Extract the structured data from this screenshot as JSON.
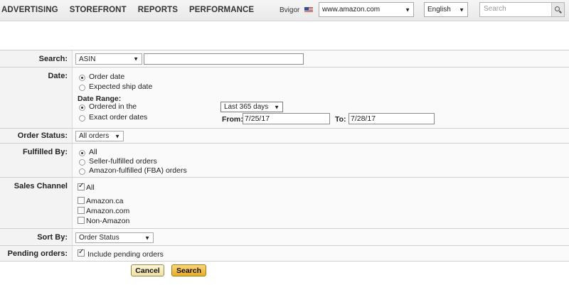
{
  "nav": {
    "items": [
      "ADVERTISING",
      "STOREFRONT",
      "REPORTS",
      "PERFORMANCE"
    ]
  },
  "header": {
    "seller_name": "Bvigor",
    "marketplace": "www.amazon.com",
    "language": "English",
    "search_placeholder": "Search"
  },
  "form": {
    "search": {
      "label": "Search:",
      "type_value": "ASIN",
      "query_value": ""
    },
    "date": {
      "label": "Date:",
      "order_date": "Order date",
      "ship_date": "Expected ship date",
      "range_label": "Date Range:",
      "ordered_in": "Ordered in the",
      "exact_dates": "Exact order dates",
      "period_value": "Last 365 days",
      "from_label": "From:",
      "from_value": "7/25/17",
      "to_label": "To:",
      "to_value": "7/28/17"
    },
    "order_status": {
      "label": "Order Status:",
      "value": "All orders"
    },
    "fulfilled_by": {
      "label": "Fulfilled By:",
      "options": [
        "All",
        "Seller-fulfilled orders",
        "Amazon-fulfilled (FBA) orders"
      ]
    },
    "sales_channel": {
      "label": "Sales Channel",
      "all": "All",
      "options": [
        "Amazon.ca",
        "Amazon.com",
        "Non-Amazon"
      ]
    },
    "sort_by": {
      "label": "Sort By:",
      "value": "Order Status"
    },
    "pending": {
      "label": "Pending orders:",
      "checkbox": "Include pending orders"
    }
  },
  "buttons": {
    "cancel": "Cancel",
    "search": "Search"
  }
}
